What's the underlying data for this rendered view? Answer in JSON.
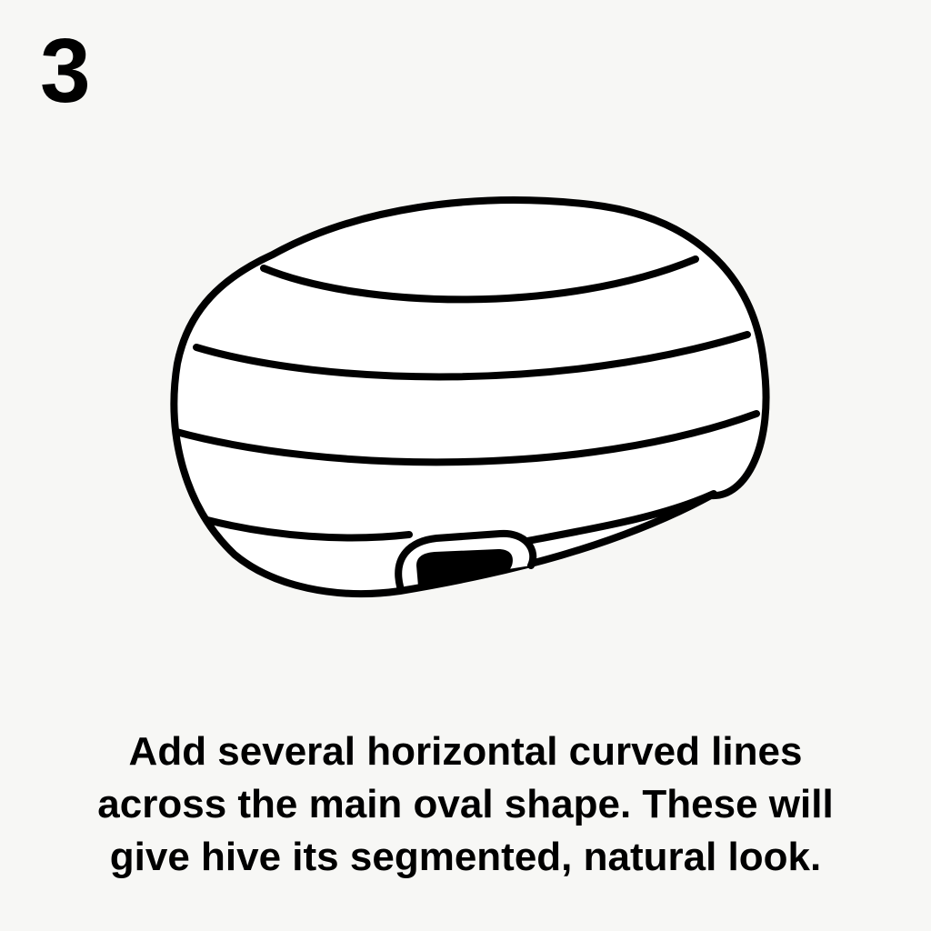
{
  "step": {
    "number": "3"
  },
  "illustration": {
    "subject": "beehive-icon",
    "stroke_color": "#000000",
    "fill_color": "#ffffff",
    "segment_lines": 4
  },
  "caption": {
    "lines": [
      "Add several horizontal curved lines",
      "across the main oval shape. These will",
      "give hive its segmented, natural look."
    ]
  },
  "colors": {
    "background": "#f7f7f5",
    "ink": "#000000"
  }
}
